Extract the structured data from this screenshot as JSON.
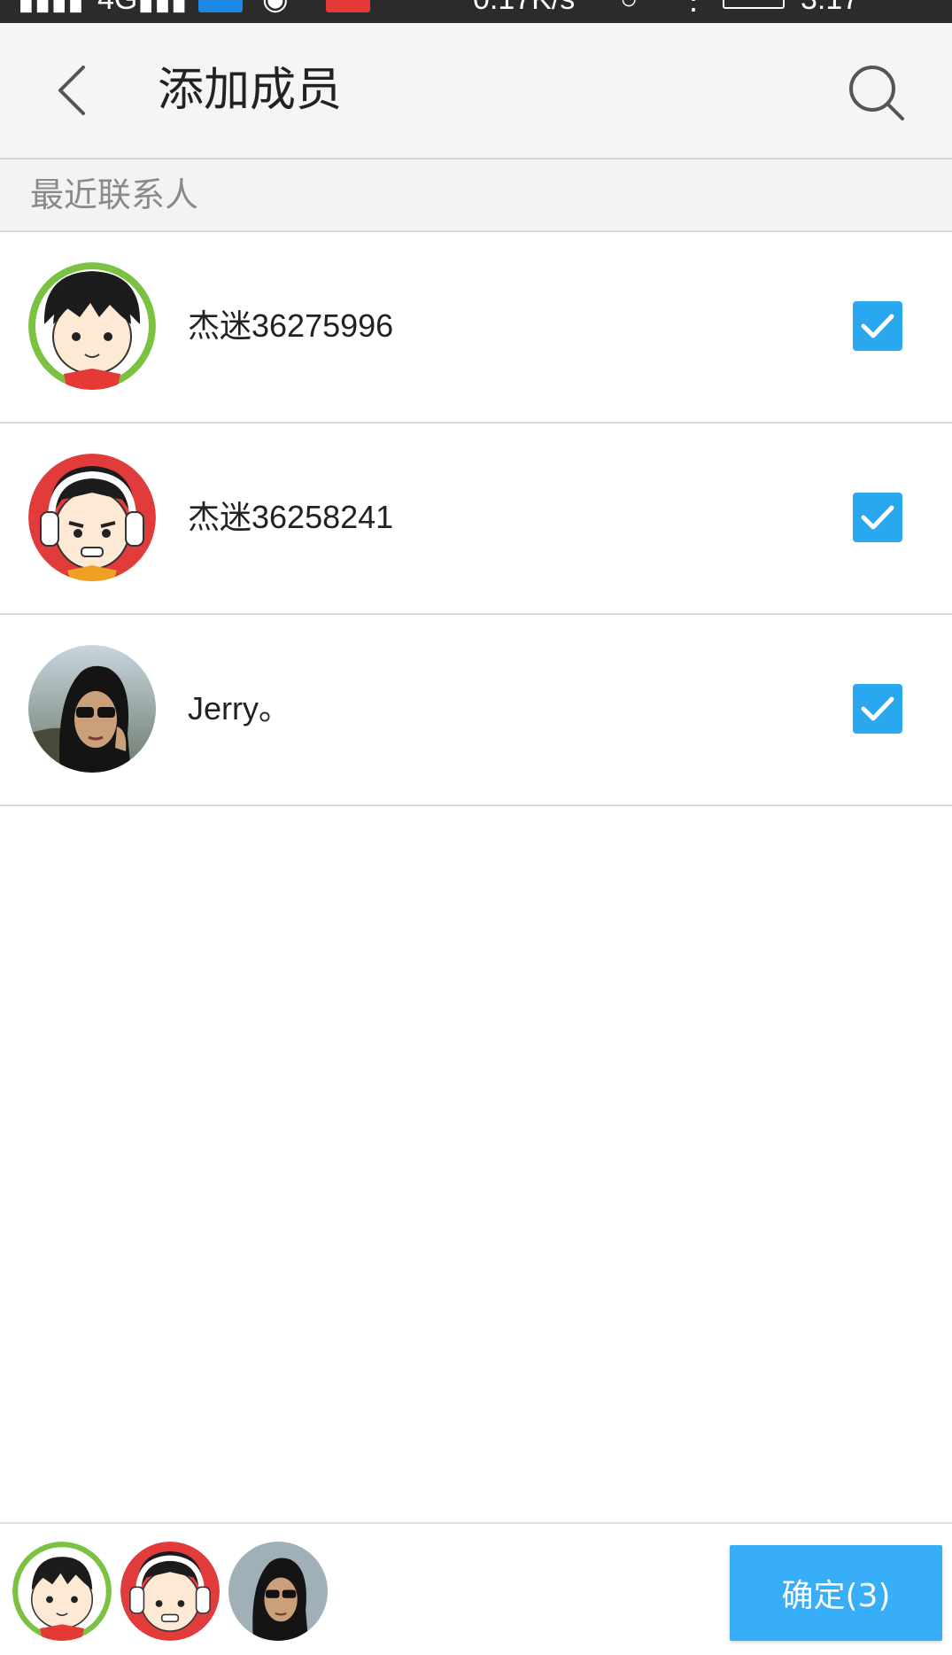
{
  "status_bar": {
    "speed": "0.17K/s",
    "time": "3:17"
  },
  "header": {
    "title": "添加成员",
    "back_icon": "chevron-left-icon",
    "search_icon": "search-icon"
  },
  "section": {
    "title": "最近联系人"
  },
  "contacts": [
    {
      "name": "杰迷36275996",
      "checked": true,
      "avatar": "cartoon-boy-green"
    },
    {
      "name": "杰迷36258241",
      "checked": true,
      "avatar": "cartoon-boy-red-headphones"
    },
    {
      "name": "Jerry。",
      "checked": true,
      "avatar": "photo-woman-sunglasses"
    }
  ],
  "bottom_bar": {
    "confirm_label": "确定(3)"
  },
  "colors": {
    "accent": "#37aef7",
    "checkbox": "#29a8f0",
    "header_bg": "#f5f5f5",
    "section_text": "#8a8a8a"
  }
}
